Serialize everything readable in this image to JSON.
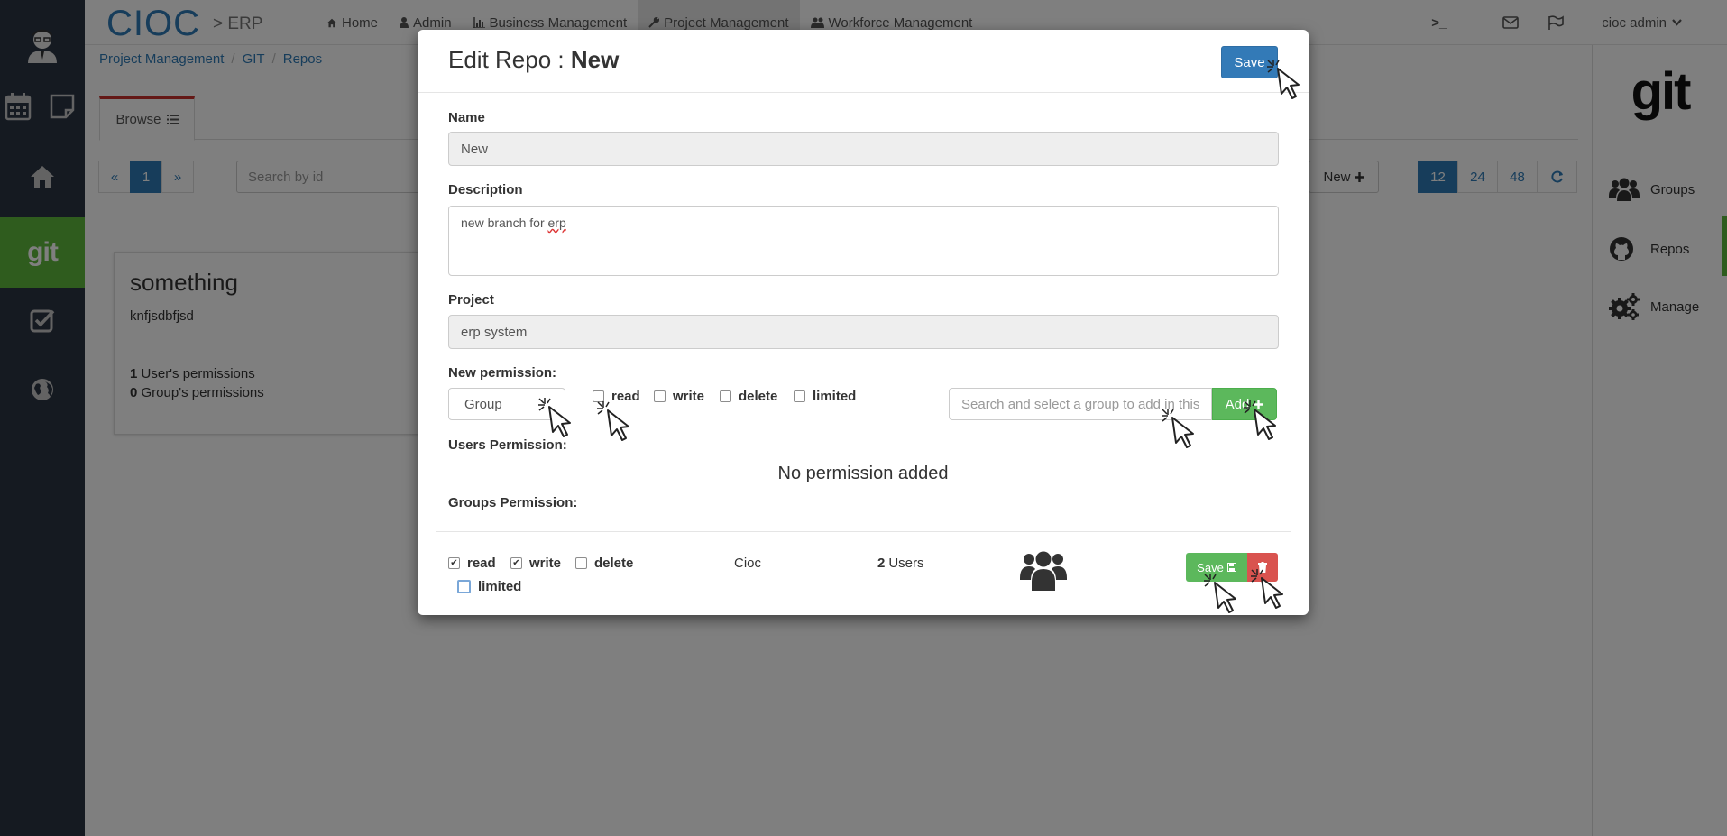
{
  "topnav": {
    "brand": "CIOC",
    "brand_sub": "> ERP",
    "items": [
      {
        "label": "Home",
        "icon": "home-icon"
      },
      {
        "label": "Admin",
        "icon": "user-icon"
      },
      {
        "label": "Business Management",
        "icon": "bar-chart-icon"
      },
      {
        "label": "Project Management",
        "icon": "wrench-icon"
      },
      {
        "label": "Workforce Management",
        "icon": "users-icon"
      }
    ],
    "terminal": ">_",
    "user": "cioc admin"
  },
  "breadcrumb": [
    "Project Management",
    "GIT",
    "Repos"
  ],
  "tabs": {
    "browse": "Browse"
  },
  "pager": {
    "prev": "«",
    "current": "1",
    "next": "»"
  },
  "search": {
    "placeholder": "Search by id"
  },
  "new_button": "New",
  "page_sizes": [
    "12",
    "24",
    "48"
  ],
  "card": {
    "title": "something",
    "description": "knfjsdbfjsd",
    "users_count": "1",
    "users_label": "User's permissions",
    "groups_count": "0",
    "groups_label": "Group's permissions"
  },
  "rightpanel": {
    "logo": "git",
    "items": [
      "Groups",
      "Repos",
      "Manage"
    ]
  },
  "sidebar": {
    "git_label": "git",
    "active_color": "#5fb83c"
  },
  "modal": {
    "title_prefix": "Edit Repo : ",
    "title_name": "New",
    "save": "Save",
    "name_label": "Name",
    "name_value": "New",
    "description_label": "Description",
    "description_value_plain": "new branch for ",
    "description_value_spell": "erp",
    "project_label": "Project",
    "project_value": "erp system",
    "new_permission_label": "New permission:",
    "group_select": "Group",
    "perm_options": [
      "read",
      "write",
      "delete",
      "limited"
    ],
    "group_search_placeholder": "Search and select a group to add in this",
    "add_label": "Add",
    "users_permission_label": "Users Permission:",
    "no_permission": "No permission added",
    "groups_permission_label": "Groups Permission:",
    "row": {
      "read": "read",
      "write": "write",
      "delete": "delete",
      "limited": "limited",
      "read_checked": true,
      "write_checked": true,
      "delete_checked": false,
      "limited_checked": false,
      "group_name": "Cioc",
      "users_count": "2",
      "users_label": "Users",
      "save_label": "Save"
    }
  },
  "colors": {
    "primary": "#337ab7",
    "success": "#5cb85c",
    "danger": "#d9534f",
    "sidebar": "#2b3442"
  }
}
